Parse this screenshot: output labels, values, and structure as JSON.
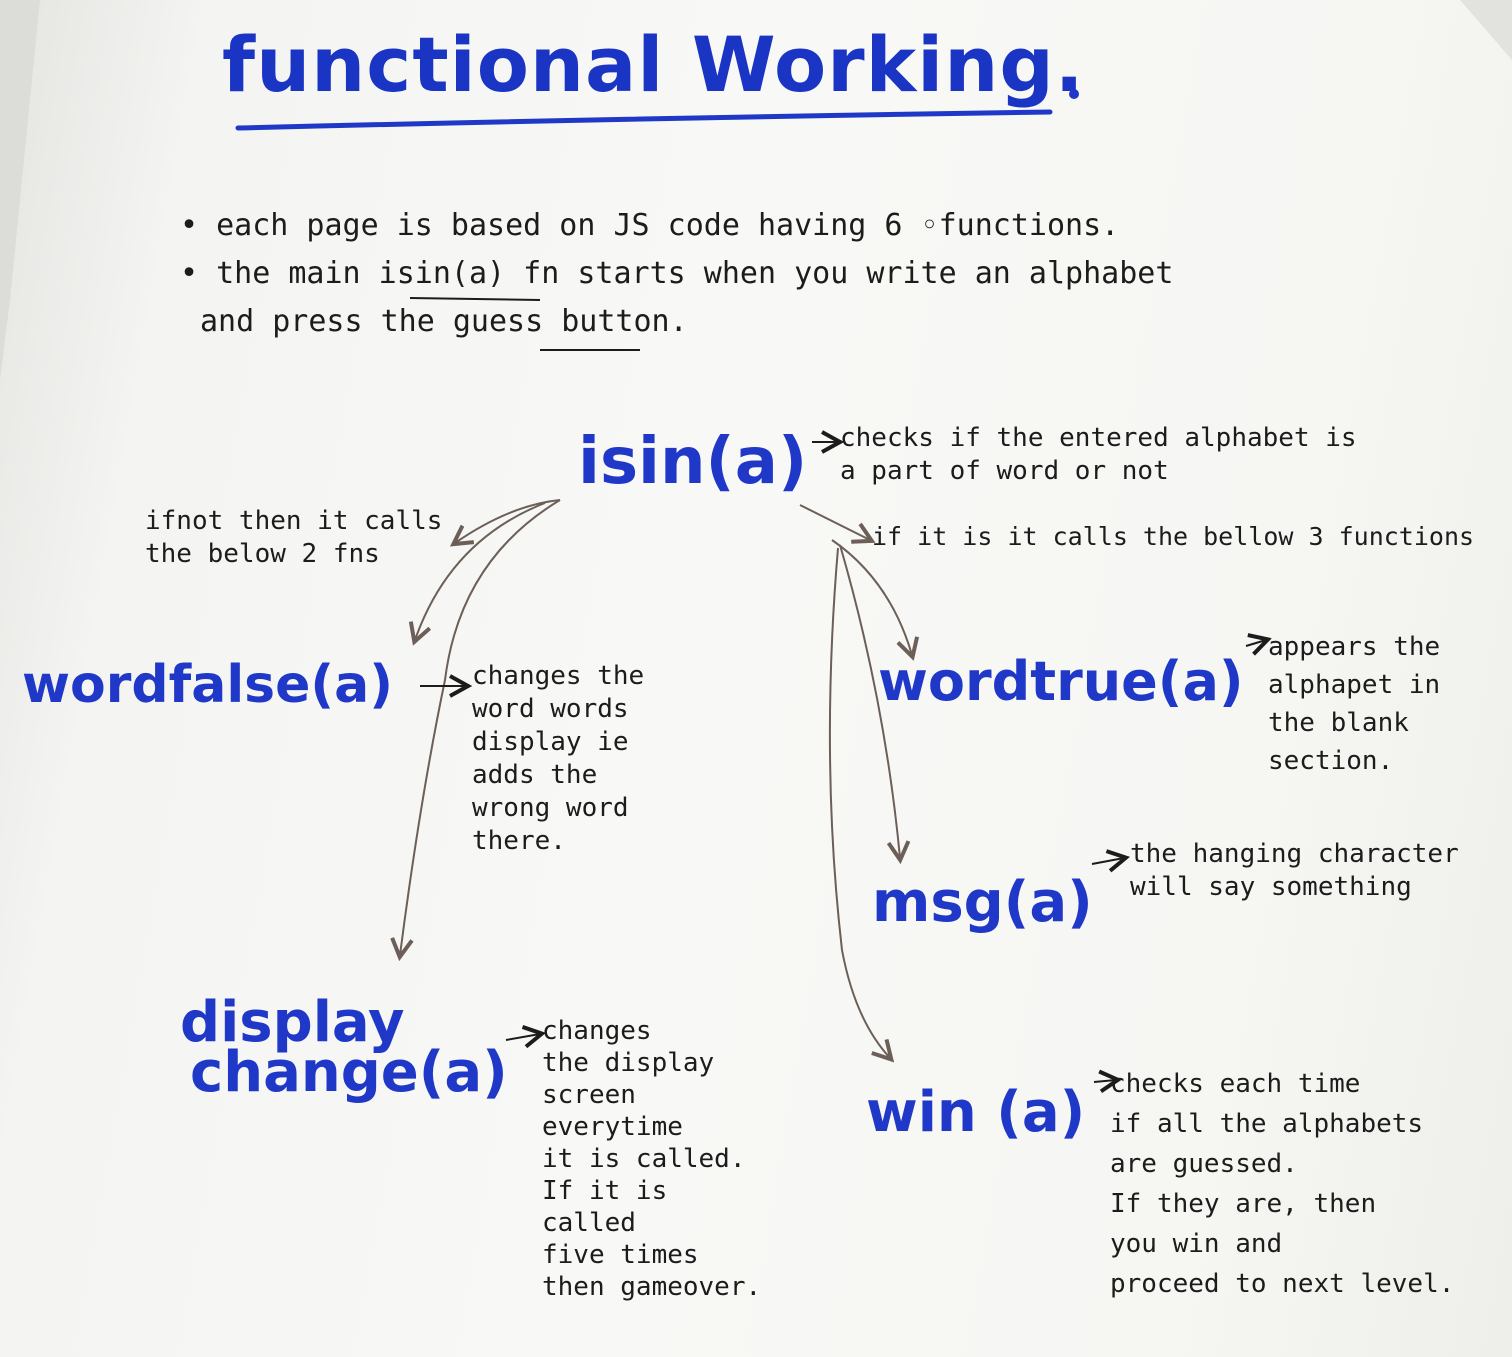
{
  "title": "functional Working.",
  "intro": {
    "line1": "• each page is based on JS code having 6 ◦functions.",
    "line2": "• the main isin(a) fn starts when you write an alphabet",
    "line3": "and press the guess button."
  },
  "nodes": {
    "isin": {
      "label": "isin(a)",
      "note": "checks if the entered alphabet is\na part of word or not"
    },
    "wordfalse": {
      "label": "wordfalse(a)",
      "note": "changes the\nword words\ndisplay ie\nadds the\nwrong word\nthere."
    },
    "display_change": {
      "label_line1": "display",
      "label_line2": "change(a)",
      "note": "changes\nthe display\nscreen\neverytime\nit is called.\nIf it is\ncalled\nfive times\nthen gameover."
    },
    "wordtrue": {
      "label": "wordtrue(a)",
      "note": "appears the\nalphapet in\nthe blank\nsection."
    },
    "msg": {
      "label": "msg(a)",
      "note": "the hanging character\nwill say something"
    },
    "win": {
      "label": "win (a)",
      "note": "checks each time\nif all the alphabets\nare guessed.\nIf they are, then\nyou win and\nproceed to next level."
    }
  },
  "branches": {
    "left": "ifnot then it calls\nthe below 2 fns",
    "right": "if it is it calls the bellow 3 functions"
  },
  "colors": {
    "ink_blue": "#1f38c8",
    "ink_black": "#1c1c1c",
    "pencil": "#6b5f57",
    "paper": "#f6f6f3"
  }
}
